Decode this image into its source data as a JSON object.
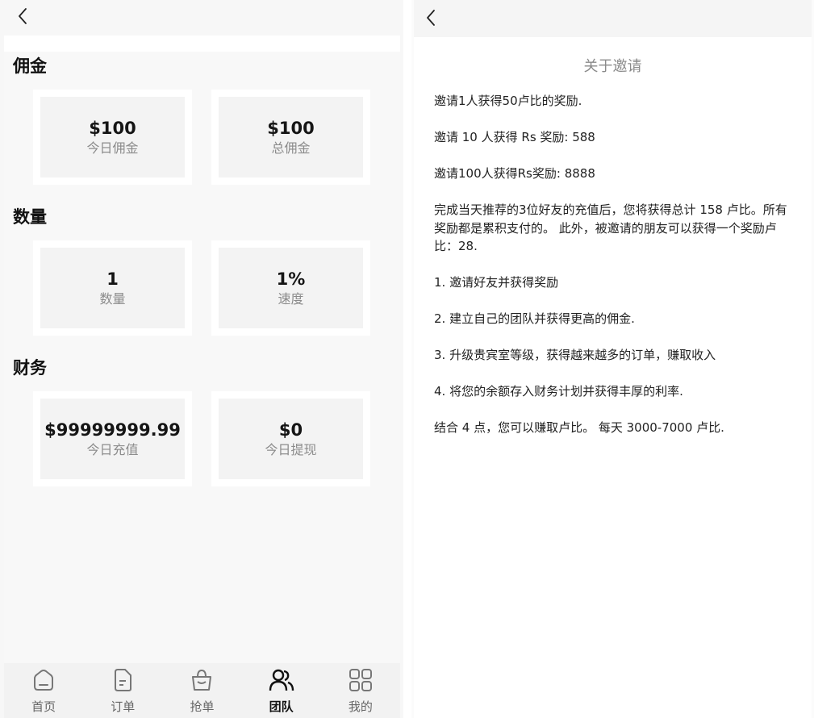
{
  "team": {
    "sections": [
      {
        "title": "佣金",
        "cards": [
          {
            "value": "$100",
            "label": "今日佣金"
          },
          {
            "value": "$100",
            "label": "总佣金"
          }
        ]
      },
      {
        "title": "数量",
        "cards": [
          {
            "value": "1",
            "label": "数量"
          },
          {
            "value": "1%",
            "label": "速度"
          }
        ]
      },
      {
        "title": "财务",
        "cards": [
          {
            "value": "$99999999.99",
            "label": "今日充值"
          },
          {
            "value": "$0",
            "label": "今日提现"
          }
        ]
      }
    ],
    "tabbar": [
      {
        "label": "首页",
        "icon": "home-icon"
      },
      {
        "label": "订单",
        "icon": "document-icon"
      },
      {
        "label": "抢单",
        "icon": "bag-icon"
      },
      {
        "label": "团队",
        "icon": "team-icon",
        "active": true
      },
      {
        "label": "我的",
        "icon": "grid-icon"
      }
    ]
  },
  "about": {
    "title": "关于邀请",
    "paragraphs": [
      "邀请1人获得50卢比的奖励.",
      "邀请 10 人获得 Rs 奖励: 588",
      "邀请100人获得Rs奖励: 8888",
      "完成当天推荐的3位好友的充值后，您将获得总计 158 卢比。所有奖励都是累积支付的。 此外，被邀请的朋友可以获得一个奖励卢比：28.",
      "1. 邀请好友并获得奖励",
      "2. 建立自己的团队并获得更高的佣金.",
      "3. 升级贵宾室等级，获得越来越多的订单，赚取收入",
      "4. 将您的余额存入财务计划并获得丰厚的利率.",
      "结合 4 点，您可以赚取卢比。 每天 3000-7000 卢比."
    ]
  },
  "colors": {
    "background": "#f7f7f7",
    "card": "#f3f3f3",
    "text": "#111111",
    "muted": "#8b8b8b"
  }
}
